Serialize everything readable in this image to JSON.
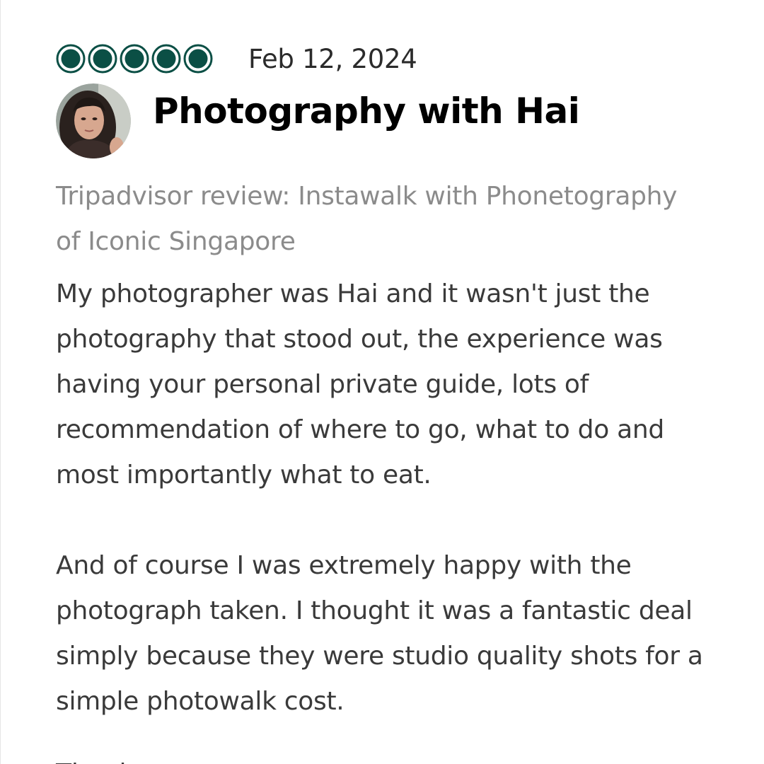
{
  "rating": {
    "bubbles_filled": 5,
    "bubbles_total": 5,
    "bubble_color": "#0b4f45",
    "icon": "rating-bubble-icon"
  },
  "review": {
    "date": "Feb 12, 2024",
    "title": "Photography with Hai",
    "source_lines": [
      "Tripadvisor review: Instawalk with Phonetography",
      "of Iconic Singapore"
    ],
    "paragraph_1_lines": [
      "My photographer was Hai and it wasn't just the",
      "photography that stood out, the experience was",
      "having your personal private guide, lots of",
      "recommendation of where to go, what to do and",
      "most importantly what to eat."
    ],
    "paragraph_2_lines": [
      "And of course I was extremely happy with the",
      "photograph taken. I thought it was a fantastic deal",
      "simply because they were studio quality shots for a",
      "simple photowalk cost."
    ],
    "cutoff_text": "Thank"
  },
  "reviewer": {
    "avatar_icon": "reviewer-avatar"
  },
  "colors": {
    "title": "#000000",
    "body": "#3a3a3a",
    "source": "#8b8b8b",
    "date": "#2b2b2b"
  }
}
